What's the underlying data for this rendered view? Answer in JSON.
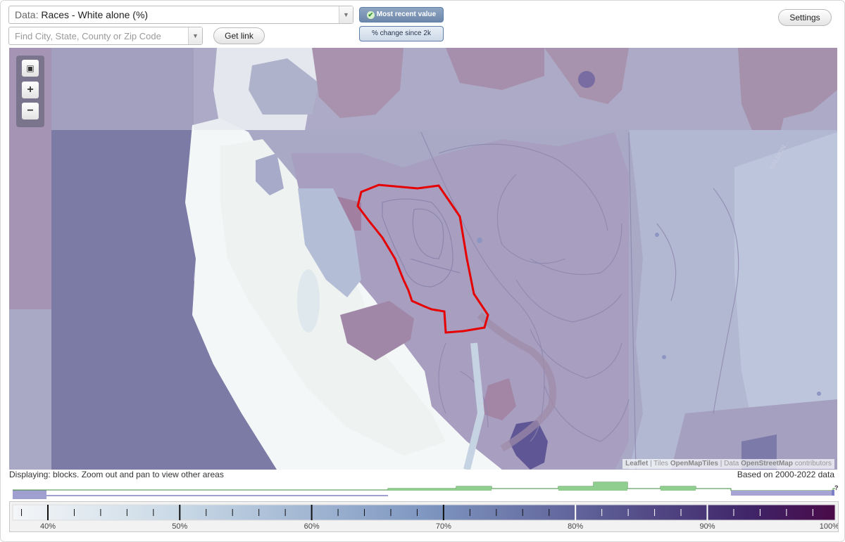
{
  "toolbar": {
    "data_prefix": "Data:",
    "data_value": "Races - White alone (%)",
    "search_placeholder": "Find City, State, County or Zip Code",
    "get_link_label": "Get link",
    "most_recent_label": "Most recent value",
    "pct_change_label": "% change since 2k",
    "settings_label": "Settings"
  },
  "map": {
    "zoom_controls": [
      "fullscreen-icon",
      "zoom-in-icon",
      "zoom-out-icon"
    ],
    "attribution": {
      "leaflet": "Leaflet",
      "sep1": " | Tiles ",
      "tiles": "OpenMapTiles",
      "sep2": " | Data ",
      "data": "OpenStreetMap",
      "suffix": " contributors"
    },
    "highlight_color": "#e60000",
    "road_label": "BALMON...",
    "displaying": "Displaying: blocks. Zoom out and pan to view other areas",
    "based_on": "Based on 2000-2022 data"
  },
  "legend": {
    "ticks": [
      "40%",
      "50%",
      "60%",
      "70%",
      "80%",
      "90%",
      "100%"
    ],
    "help": "?",
    "gradient_colors": [
      "#f4f6f8",
      "#c9d9e6",
      "#7f97c1",
      "#5b5a93",
      "#3f2467",
      "#4a0a48"
    ]
  }
}
